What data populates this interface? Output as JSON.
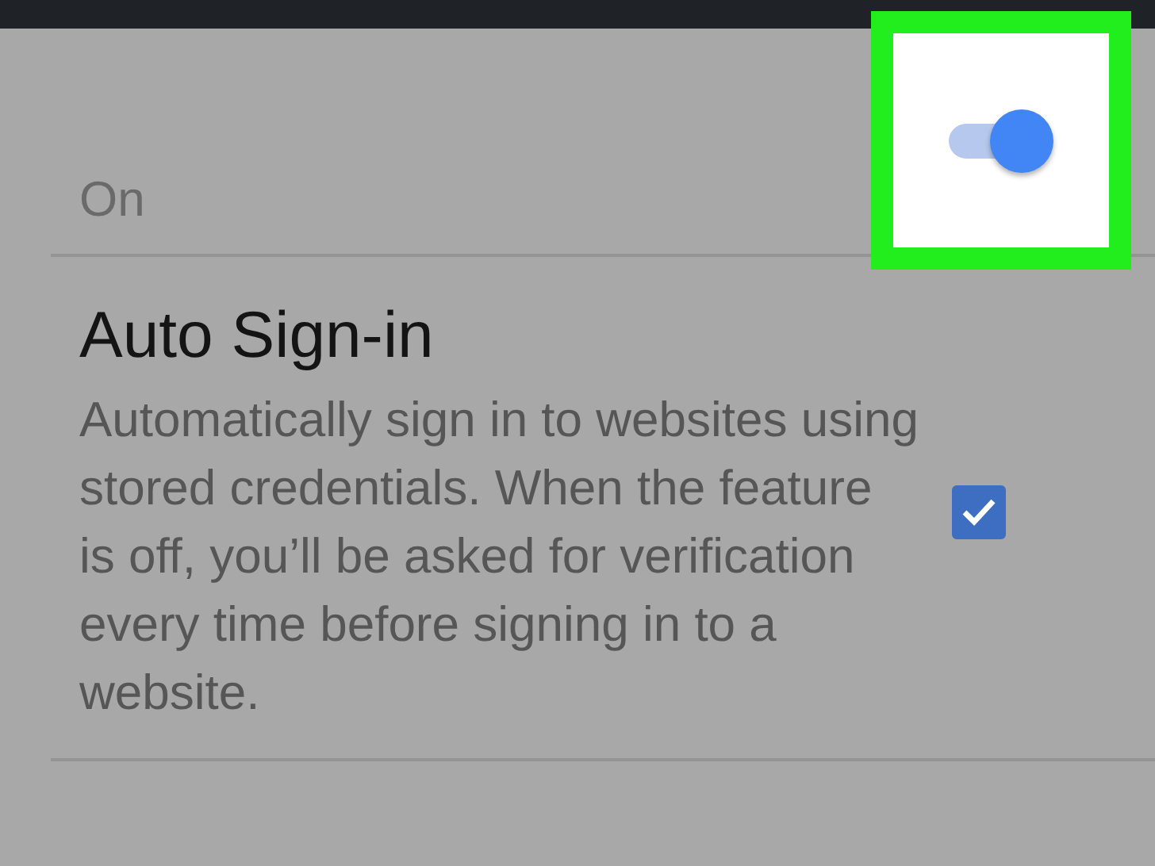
{
  "master_switch": {
    "label": "On",
    "on": true,
    "highlighted": true
  },
  "settings": [
    {
      "kind": "checkbox",
      "title": "Auto Sign-in",
      "description": "Automatically sign in to websites using stored credentials. When the feature is off, you’ll be asked for verification every time before signing in to a website.",
      "checked": true
    }
  ]
}
